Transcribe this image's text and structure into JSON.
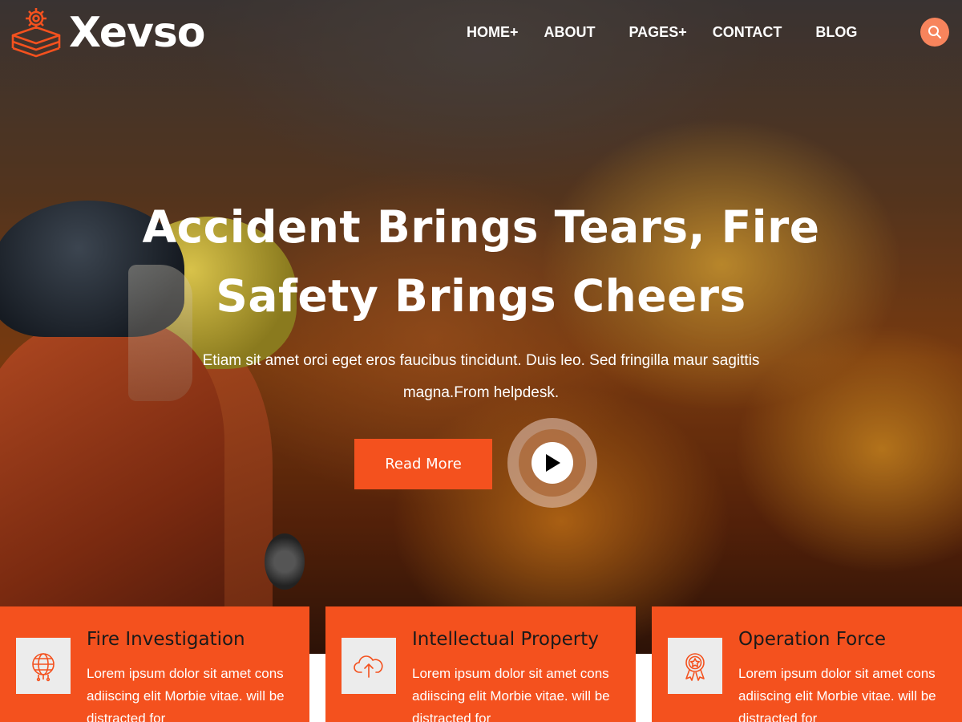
{
  "brand": {
    "name": "Xevso",
    "accent": "#f4511e"
  },
  "nav": {
    "items": [
      {
        "label": "HOME+"
      },
      {
        "label": "ABOUT"
      },
      {
        "label": "PAGES+"
      },
      {
        "label": "CONTACT"
      },
      {
        "label": "BLOG"
      }
    ],
    "search_icon": "search-icon"
  },
  "hero": {
    "title": "Accident Brings Tears, Fire Safety Brings Cheers",
    "description": "Etiam sit amet orci eget eros faucibus tincidunt. Duis leo. Sed fringilla maur sagittis magna.From helpdesk.",
    "cta_label": "Read More",
    "play_icon": "play-icon"
  },
  "cards": [
    {
      "title": "Fire Investigation",
      "text": "Lorem ipsum dolor sit amet cons adiiscing elit Morbie vitae. will be distracted for",
      "icon": "globe-circuit-icon"
    },
    {
      "title": "Intellectual Property",
      "text": "Lorem ipsum dolor sit amet cons adiiscing elit Morbie vitae. will be distracted for",
      "icon": "cloud-upload-icon"
    },
    {
      "title": "Operation Force",
      "text": "Lorem ipsum dolor sit amet cons adiiscing elit Morbie vitae. will be distracted for",
      "icon": "award-badge-icon"
    }
  ]
}
